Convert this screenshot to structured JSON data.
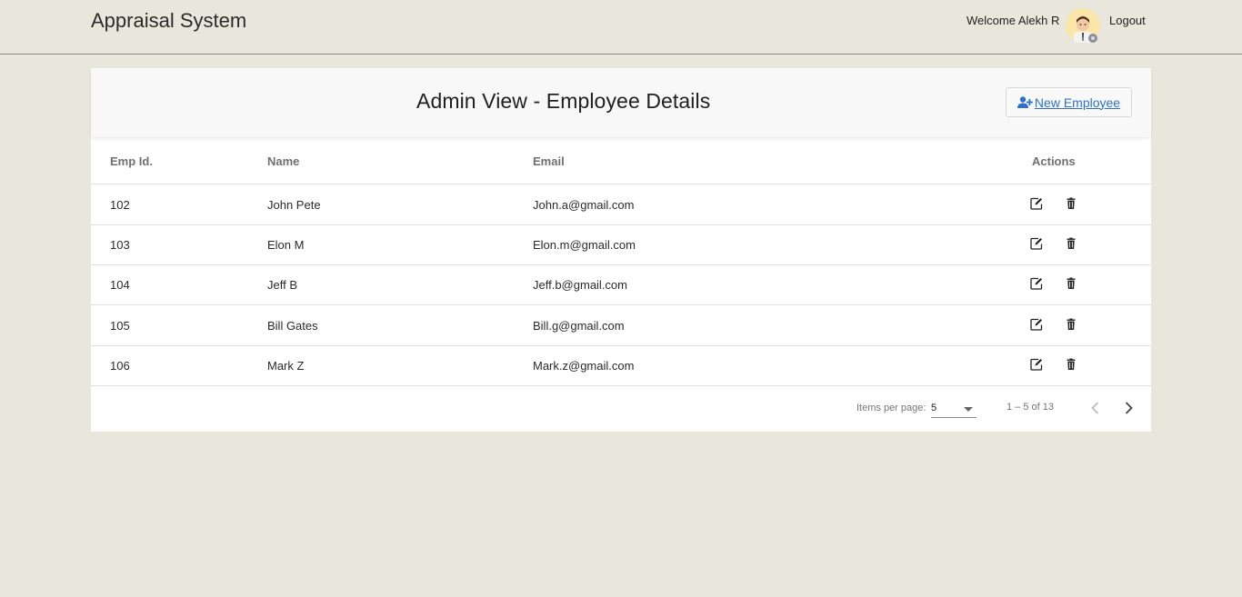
{
  "header": {
    "app_title": "Appraisal System",
    "welcome": "Welcome Alekh R",
    "logout": "Logout"
  },
  "page": {
    "title": "Admin View - Employee Details",
    "new_button_label": " New Employee",
    "new_button_icon": "user-plus-icon"
  },
  "table": {
    "columns": [
      "Emp Id.",
      "Name",
      "Email",
      "Actions"
    ],
    "rows": [
      [
        "102",
        "John Pete",
        "John.a@gmail.com"
      ],
      [
        "103",
        "Elon M",
        "Elon.m@gmail.com"
      ],
      [
        "104",
        "Jeff B",
        "Jeff.b@gmail.com"
      ],
      [
        "105",
        "Bill Gates",
        "Bill.g@gmail.com"
      ],
      [
        "106",
        "Mark Z",
        "Mark.z@gmail.com"
      ]
    ],
    "action_icons": [
      "edit-icon",
      "trash-icon"
    ]
  },
  "paginator": {
    "items_per_page_label": "Items per page:",
    "items_per_page_value": "5",
    "range_label": "1 – 5 of 13"
  },
  "colors": {
    "background": "#e9e6db",
    "accent": "#2f71c9"
  }
}
